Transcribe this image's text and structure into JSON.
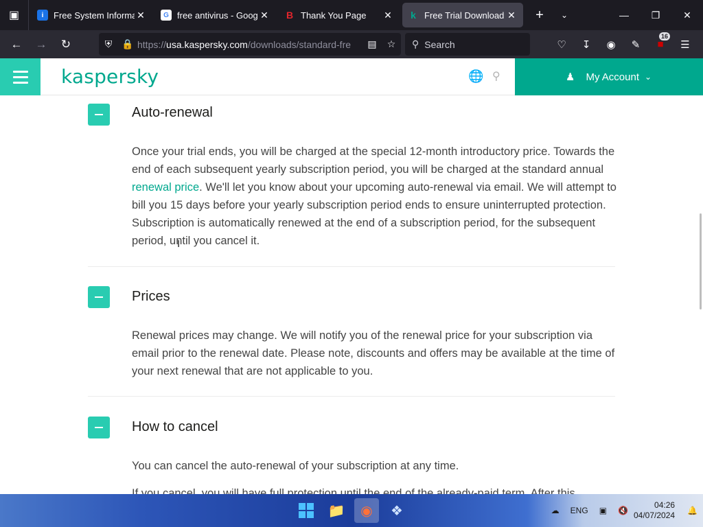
{
  "browser": {
    "tabs": [
      {
        "title": "Free System Informatic",
        "favicon_color": "#1a73e8",
        "favicon_glyph": "i",
        "active": false
      },
      {
        "title": "free antivirus - Google",
        "favicon_color": "#ffffff",
        "favicon_glyph": "G",
        "active": false
      },
      {
        "title": "Thank You Page",
        "favicon_color": "#1c1b22",
        "favicon_glyph": "B",
        "active": false
      },
      {
        "title": "Free Trial Download - I",
        "favicon_color": "#00a88e",
        "favicon_glyph": "k",
        "active": true
      }
    ],
    "url_host": "usa.kaspersky.com",
    "url_prefix": "https://",
    "url_path": "/downloads/standard-fre",
    "search_placeholder": "Search",
    "extension_badge": "16"
  },
  "site": {
    "logo": "kaspersky",
    "account_label": "My Account",
    "accent_color": "#00a88e"
  },
  "sections": [
    {
      "title": "Auto-renewal",
      "body_before_link": "Once your trial ends, you will be charged at the special 12-month introductory price. Towards the end of each subsequent yearly subscription period, you will be charged at the standard annual ",
      "link": "renewal price",
      "body_after_link": ". We'll let you know about your upcoming auto-renewal via email. We will attempt to bill you 15 days before your yearly subscription period ends to ensure uninterrupted protection. Subscription is automatically renewed at the end of a subscription period, for the subsequent period, until you cancel it."
    },
    {
      "title": "Prices",
      "body": "Renewal prices may change. We will notify you of the renewal price for your subscription via email prior to the renewal date. Please note, discounts and offers may be available at the time of your next renewal that are not applicable to you."
    },
    {
      "title": "How to cancel",
      "body": "You can cancel the auto-renewal of your subscription at any time.",
      "body2": "If you cancel, you will have full protection until the end of the already-paid term. After this"
    }
  ],
  "taskbar": {
    "language": "ENG",
    "time": "04:26",
    "date": "04/07/2024"
  }
}
